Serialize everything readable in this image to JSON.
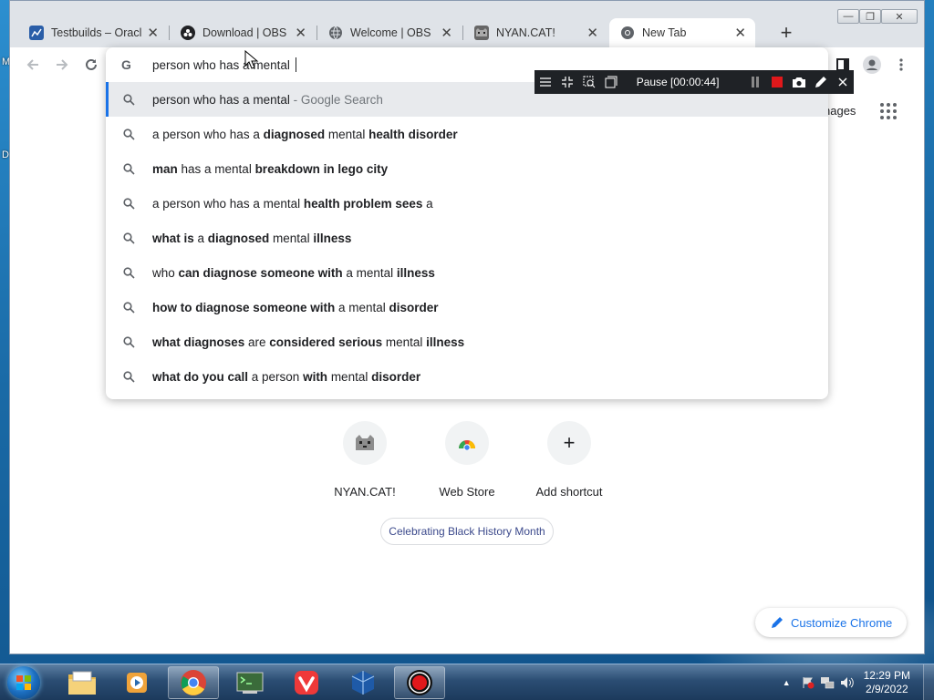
{
  "desktop_labels": [
    "M",
    "D"
  ],
  "window_controls": {
    "minimize": "—",
    "restore": "❐",
    "close": "✕"
  },
  "tabs": [
    {
      "title": "Testbuilds – Oracle",
      "icon": "graph-icon",
      "close": "✕",
      "active": false
    },
    {
      "title": "Download | OBS",
      "icon": "obs-icon",
      "close": "✕",
      "active": false
    },
    {
      "title": "Welcome | OBS",
      "icon": "globe-icon",
      "close": "✕",
      "active": false
    },
    {
      "title": "NYAN.CAT!",
      "icon": "nyan-cat-icon",
      "close": "✕",
      "active": false
    },
    {
      "title": "New Tab",
      "icon": "chrome-icon",
      "close": "✕",
      "active": true
    }
  ],
  "new_tab_button": "+",
  "omnibox": {
    "input_value": "person who has a mental ",
    "suggestions": [
      {
        "parts": [
          {
            "t": "person who has a mental",
            "b": false
          }
        ],
        "suffix": " - Google Search",
        "selected": true
      },
      {
        "parts": [
          {
            "t": "a person who has a ",
            "b": false
          },
          {
            "t": "diagnosed",
            "b": true
          },
          {
            "t": " mental ",
            "b": false
          },
          {
            "t": "health disorder",
            "b": true
          }
        ]
      },
      {
        "parts": [
          {
            "t": "man",
            "b": true
          },
          {
            "t": " has a mental ",
            "b": false
          },
          {
            "t": "breakdown in lego city",
            "b": true
          }
        ]
      },
      {
        "parts": [
          {
            "t": "a person who has a mental ",
            "b": false
          },
          {
            "t": "health problem sees",
            "b": true
          },
          {
            "t": " a",
            "b": false
          }
        ]
      },
      {
        "parts": [
          {
            "t": "what is",
            "b": true
          },
          {
            "t": " a ",
            "b": false
          },
          {
            "t": "diagnosed",
            "b": true
          },
          {
            "t": " mental ",
            "b": false
          },
          {
            "t": "illness",
            "b": true
          }
        ]
      },
      {
        "parts": [
          {
            "t": "who ",
            "b": false
          },
          {
            "t": "can diagnose someone with",
            "b": true
          },
          {
            "t": " a mental ",
            "b": false
          },
          {
            "t": "illness",
            "b": true
          }
        ]
      },
      {
        "parts": [
          {
            "t": "how to diagnose someone with",
            "b": true
          },
          {
            "t": " a mental ",
            "b": false
          },
          {
            "t": "disorder",
            "b": true
          }
        ]
      },
      {
        "parts": [
          {
            "t": "what diagnoses",
            "b": true
          },
          {
            "t": " are ",
            "b": false
          },
          {
            "t": "considered serious",
            "b": true
          },
          {
            "t": " mental ",
            "b": false
          },
          {
            "t": "illness",
            "b": true
          }
        ]
      },
      {
        "parts": [
          {
            "t": "what do you call",
            "b": true
          },
          {
            "t": " a person ",
            "b": false
          },
          {
            "t": "with",
            "b": true
          },
          {
            "t": " mental ",
            "b": false
          },
          {
            "t": "disorder",
            "b": true
          }
        ]
      }
    ]
  },
  "recorder": {
    "status": "Pause [00:00:44]"
  },
  "header_link": "nages",
  "shortcuts": [
    {
      "label": "NYAN.CAT!",
      "icon": "nyan-cat-icon"
    },
    {
      "label": "Web Store",
      "icon": "web-store-icon"
    },
    {
      "label": "Add shortcut",
      "icon": "plus-icon",
      "glyph": "+"
    }
  ],
  "doodle": {
    "label": "Celebrating Black History Month"
  },
  "customize": {
    "label": "Customize Chrome"
  },
  "taskbar": {
    "apps": [
      "explorer",
      "media-player",
      "chrome",
      "terminal",
      "vivaldi",
      "virtualbox",
      "obs"
    ],
    "clock": {
      "time": "12:29 PM",
      "date": "2/9/2022"
    },
    "tray_arrow": "▲"
  },
  "colors": {
    "accent": "#1a73e8",
    "selected_row": "#e8eaed",
    "recorder_bg": "#1f2226",
    "record_red": "#e0181b"
  }
}
